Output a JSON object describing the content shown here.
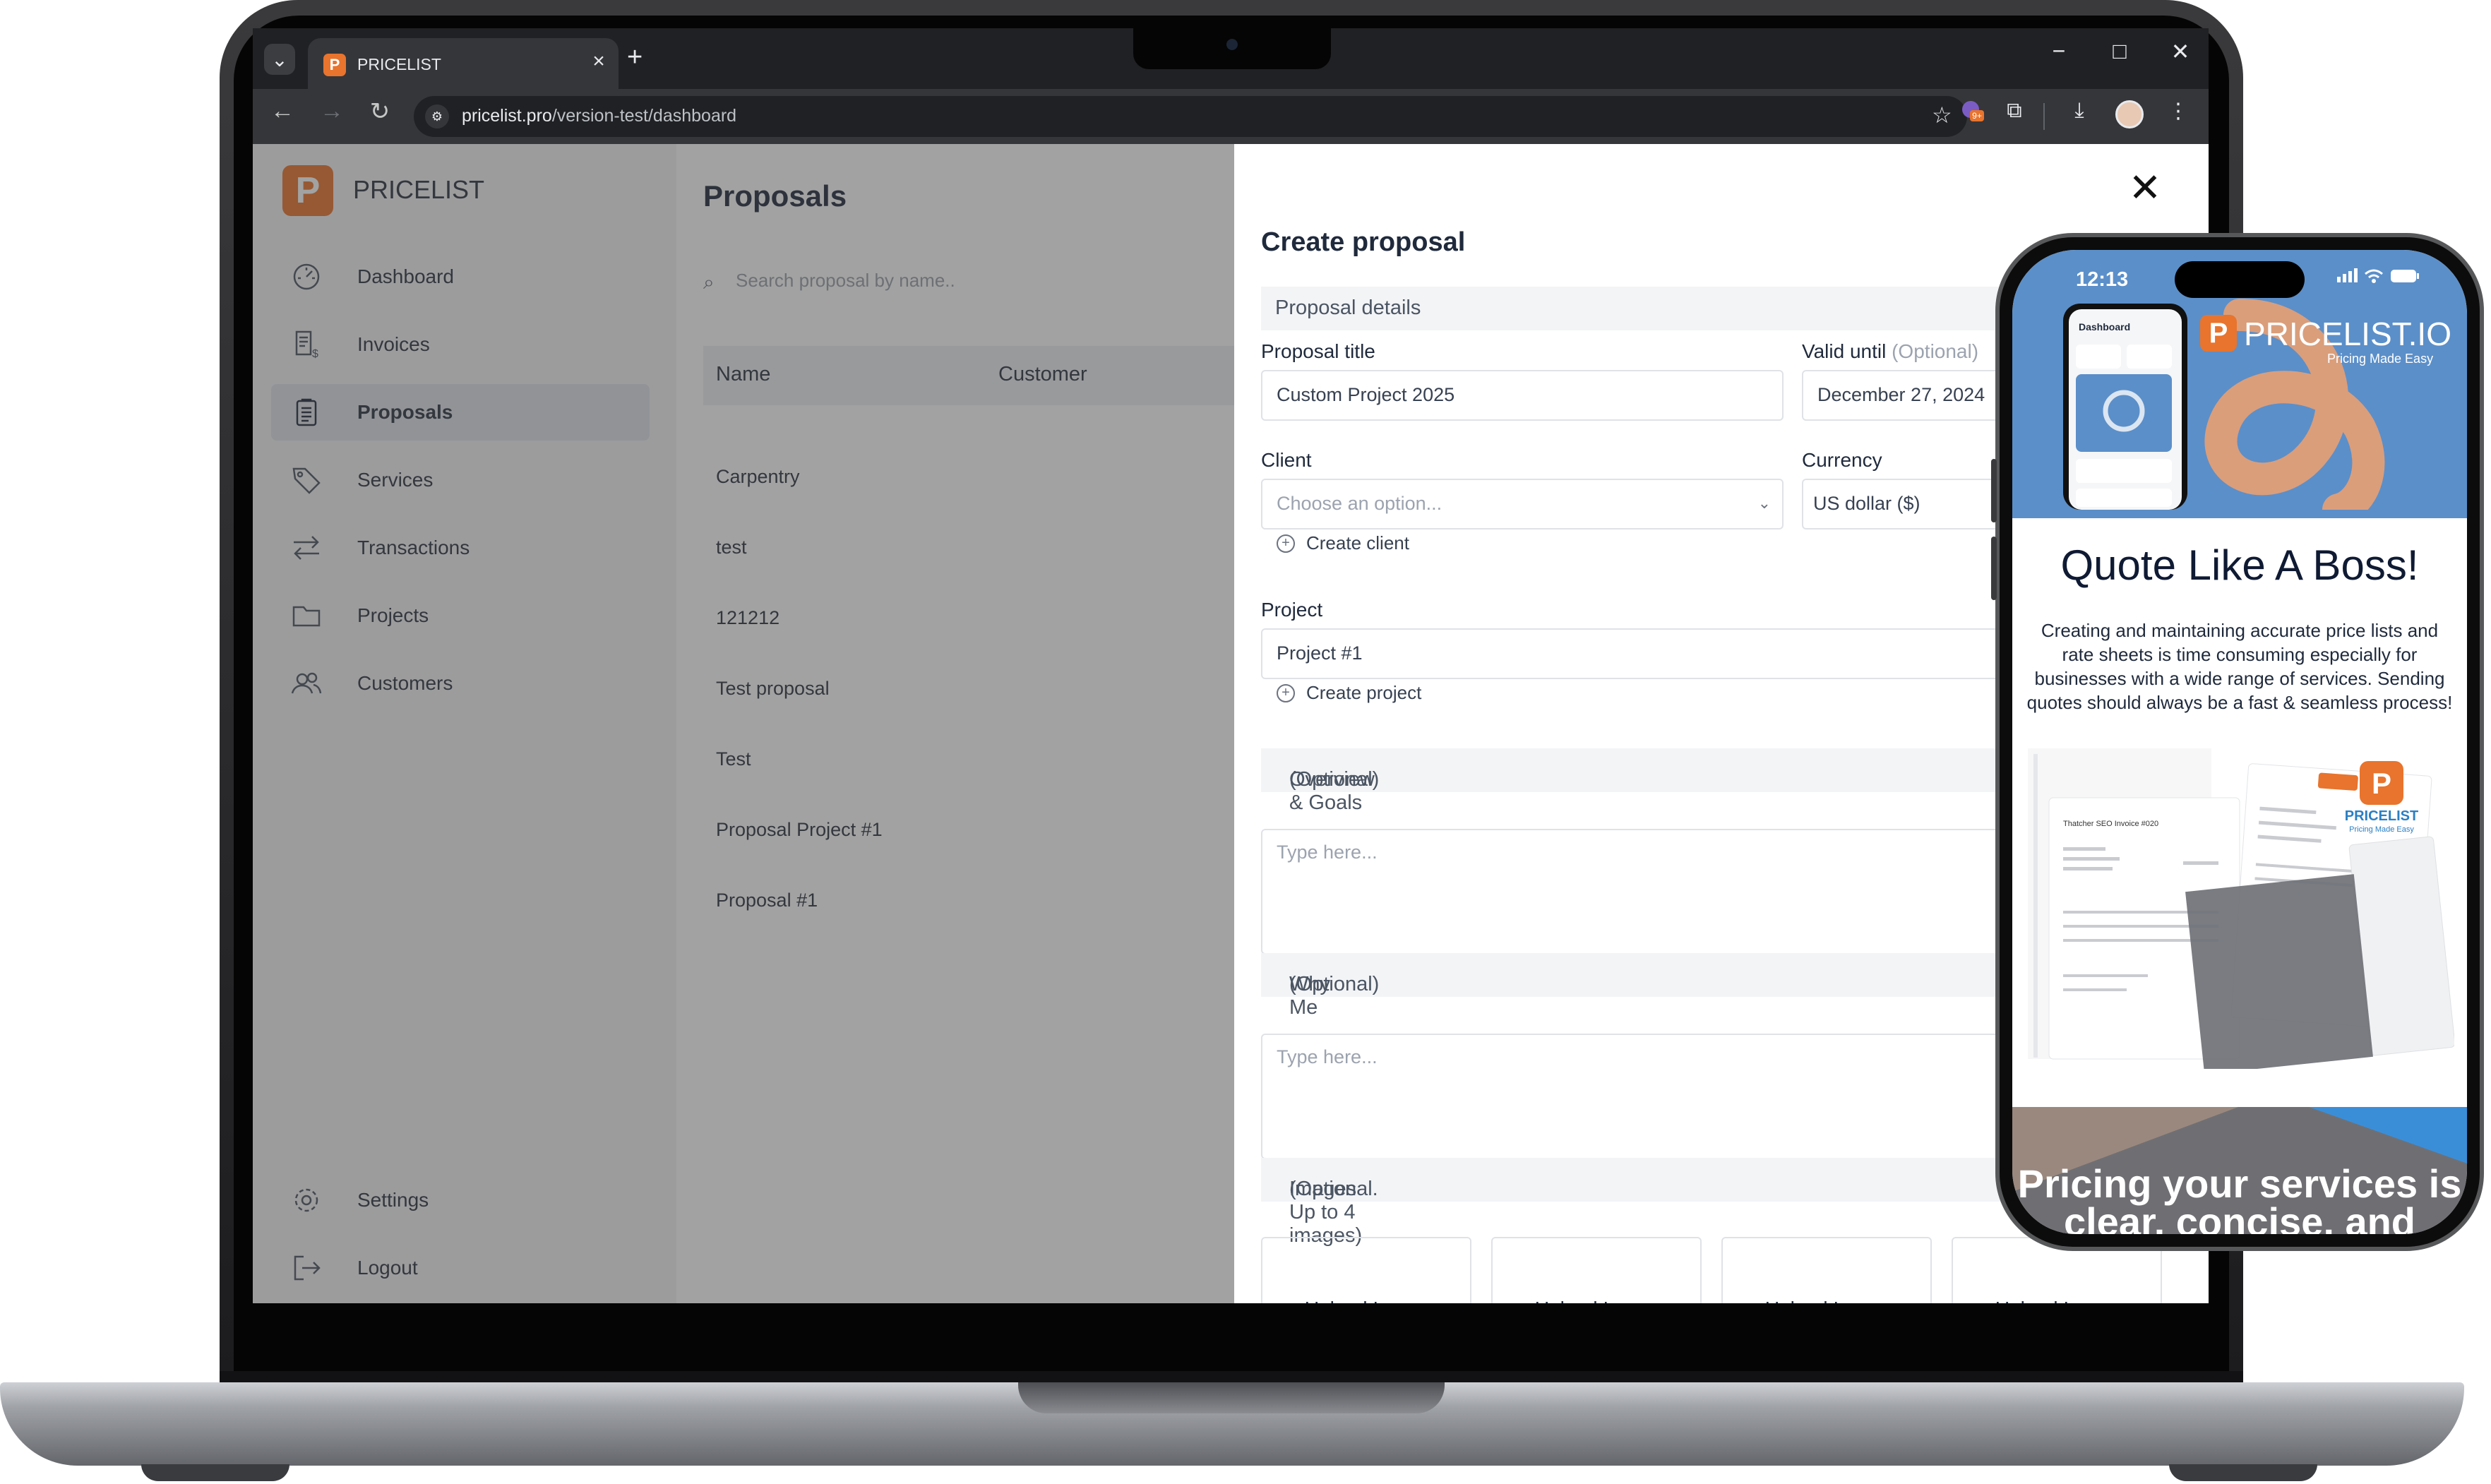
{
  "browser": {
    "tab_title": "PRICELIST",
    "url_host": "pricelist.pro",
    "url_path": "/version-test/dashboard",
    "tab_close": "×",
    "new_tab": "+",
    "win_min": "−",
    "win_max": "□",
    "win_close": "✕",
    "extension_badge": "9+"
  },
  "sidebar": {
    "brand": "PRICELIST",
    "logo_letter": "P",
    "items": [
      {
        "label": "Dashboard",
        "icon": "gauge-icon"
      },
      {
        "label": "Invoices",
        "icon": "invoice-icon"
      },
      {
        "label": "Proposals",
        "icon": "clipboard-icon",
        "active": true
      },
      {
        "label": "Services",
        "icon": "tag-icon"
      },
      {
        "label": "Transactions",
        "icon": "arrows-icon"
      },
      {
        "label": "Projects",
        "icon": "folder-icon"
      },
      {
        "label": "Customers",
        "icon": "users-icon"
      }
    ],
    "bottom": [
      {
        "label": "Settings",
        "icon": "gear-icon"
      },
      {
        "label": "Logout",
        "icon": "logout-icon"
      }
    ]
  },
  "proposals": {
    "title": "Proposals",
    "search_placeholder": "Search proposal by name..",
    "columns": [
      "Name",
      "Customer"
    ],
    "rows": [
      "Carpentry",
      "test",
      "121212",
      "Test proposal",
      "Test",
      "Proposal Project #1",
      "Proposal #1"
    ]
  },
  "drawer": {
    "title": "Create proposal",
    "close": "✕",
    "details_header": "Proposal details",
    "proposal_title_label": "Proposal title",
    "proposal_title_value": "Custom Project 2025",
    "valid_until_label": "Valid until",
    "optional": "(Optional)",
    "valid_until_value": "December 27, 2024",
    "client_label": "Client",
    "client_placeholder": "Choose an option...",
    "currency_label": "Currency",
    "currency_value": "US dollar ($)",
    "create_client": "Create client",
    "project_label": "Project",
    "project_value": "Project #1",
    "create_project": "Create project",
    "overview_label": "Overview & Goals",
    "overview_opt": "(Optional)",
    "overview_placeholder": "Type here...",
    "whyme_label": "Why Me",
    "whyme_opt": "(Optional)",
    "whyme_placeholder": "Type here...",
    "images_label": "Images",
    "images_opt": "(Optional. Up to 4 images)",
    "upload": [
      "Upload Image",
      "Upload Image",
      "Upload Image",
      "Upload Image"
    ]
  },
  "phone": {
    "time": "12:13",
    "brand": "PRICELIST.IO",
    "tagline": "Pricing Made Easy",
    "mini_brand": "PRICELIST",
    "mini_tagline": "Pricing Made Easy",
    "mini_dash": "Dashboard",
    "mini_invoice": "Thatcher SEO Invoice #020",
    "heading": "Quote Like A Boss!",
    "paragraph": "Creating and maintaining accurate price lists and rate sheets is time consuming especially for businesses with a wide range of services. Sending quotes should always be a fast & seamless process!",
    "banner": "Pricing your services is clear, concise, and"
  },
  "colors": {
    "brand_orange": "#e8742d",
    "hero_blue": "#5b8fc9"
  }
}
